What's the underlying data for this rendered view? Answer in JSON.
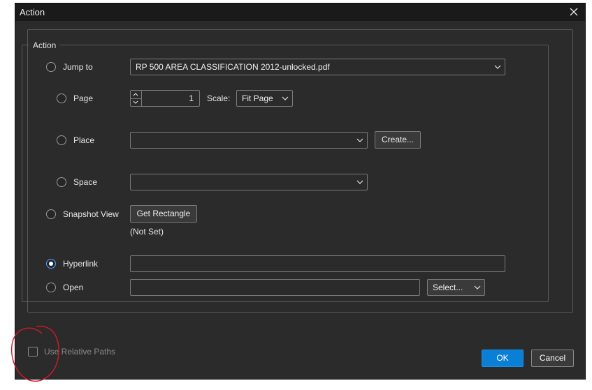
{
  "window": {
    "title": "Action"
  },
  "group": {
    "legend": "Action"
  },
  "jump_to": {
    "label": "Jump to",
    "file_value": "RP 500 AREA CLASSIFICATION 2012-unlocked.pdf"
  },
  "page": {
    "label": "Page",
    "value": "1",
    "scale_label": "Scale:",
    "scale_value": "Fit Page"
  },
  "place": {
    "label": "Place",
    "value": "",
    "create_label": "Create..."
  },
  "space": {
    "label": "Space",
    "value": ""
  },
  "snapshot": {
    "label": "Snapshot View",
    "button_label": "Get Rectangle",
    "status": "(Not Set)"
  },
  "hyperlink": {
    "label": "Hyperlink",
    "value": "",
    "selected": true
  },
  "open": {
    "label": "Open",
    "value": "",
    "select_label": "Select..."
  },
  "options": {
    "relative_paths_label": "Use Relative Paths",
    "relative_paths_checked": false
  },
  "footer": {
    "ok_label": "OK",
    "cancel_label": "Cancel"
  },
  "colors": {
    "accent": "#0a7fd6",
    "background": "#2b2b2b",
    "annotation": "#d21a2a"
  },
  "icons": {
    "close": "close-icon",
    "dropdown": "chevron-down-icon",
    "spin_up": "chevron-up-icon",
    "spin_down": "chevron-down-icon"
  }
}
